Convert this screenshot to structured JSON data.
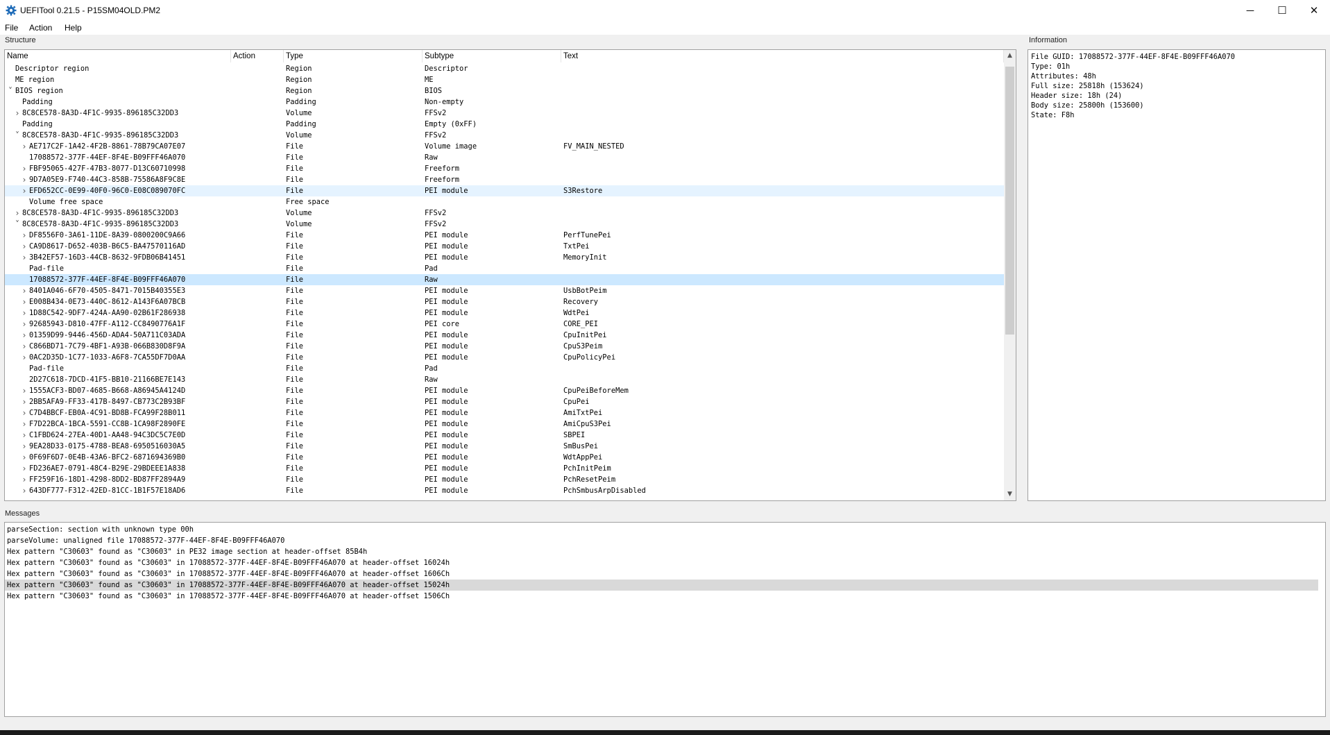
{
  "window": {
    "title": "UEFITool 0.21.5 - P15SM04OLD.PM2",
    "minimize_glyph": "─",
    "maximize_glyph": "☐",
    "close_glyph": "✕",
    "icon": "gear-icon"
  },
  "menu": [
    {
      "label": "File"
    },
    {
      "label": "Action"
    },
    {
      "label": "Help"
    }
  ],
  "structure": {
    "label": "Structure",
    "columns": [
      "Name",
      "Action",
      "Type",
      "Subtype",
      "Text"
    ],
    "rows": [
      {
        "name": "Descriptor region",
        "type": "Region",
        "subtype": "Descriptor",
        "text": ""
      },
      {
        "name": "ME region",
        "type": "Region",
        "subtype": "ME",
        "text": ""
      },
      {
        "name": "BIOS region",
        "type": "Region",
        "subtype": "BIOS",
        "text": ""
      },
      {
        "name": "Padding",
        "type": "Padding",
        "subtype": "Non-empty",
        "text": ""
      },
      {
        "name": "8C8CE578-8A3D-4F1C-9935-896185C32DD3",
        "type": "Volume",
        "subtype": "FFSv2",
        "text": ""
      },
      {
        "name": "Padding",
        "type": "Padding",
        "subtype": "Empty (0xFF)",
        "text": ""
      },
      {
        "name": "8C8CE578-8A3D-4F1C-9935-896185C32DD3",
        "type": "Volume",
        "subtype": "FFSv2",
        "text": ""
      },
      {
        "name": "AE717C2F-1A42-4F2B-8861-78B79CA07E07",
        "type": "File",
        "subtype": "Volume image",
        "text": "FV_MAIN_NESTED"
      },
      {
        "name": "17088572-377F-44EF-8F4E-B09FFF46A070",
        "type": "File",
        "subtype": "Raw",
        "text": ""
      },
      {
        "name": "FBF95065-427F-47B3-8077-D13C60710998",
        "type": "File",
        "subtype": "Freeform",
        "text": ""
      },
      {
        "name": "9D7A05E9-F740-44C3-858B-75586A8F9C8E",
        "type": "File",
        "subtype": "Freeform",
        "text": ""
      },
      {
        "name": "EFD652CC-0E99-40F0-96C0-E08C089070FC",
        "type": "File",
        "subtype": "PEI module",
        "text": "S3Restore"
      },
      {
        "name": "Volume free space",
        "type": "Free space",
        "subtype": "",
        "text": ""
      },
      {
        "name": "8C8CE578-8A3D-4F1C-9935-896185C32DD3",
        "type": "Volume",
        "subtype": "FFSv2",
        "text": ""
      },
      {
        "name": "8C8CE578-8A3D-4F1C-9935-896185C32DD3",
        "type": "Volume",
        "subtype": "FFSv2",
        "text": ""
      },
      {
        "name": "DF8556F0-3A61-11DE-8A39-0800200C9A66",
        "type": "File",
        "subtype": "PEI module",
        "text": "PerfTunePei"
      },
      {
        "name": "CA9D8617-D652-403B-B6C5-BA47570116AD",
        "type": "File",
        "subtype": "PEI module",
        "text": "TxtPei"
      },
      {
        "name": "3B42EF57-16D3-44CB-8632-9FDB06B41451",
        "type": "File",
        "subtype": "PEI module",
        "text": "MemoryInit"
      },
      {
        "name": "Pad-file",
        "type": "File",
        "subtype": "Pad",
        "text": ""
      },
      {
        "name": "17088572-377F-44EF-8F4E-B09FFF46A070",
        "type": "File",
        "subtype": "Raw",
        "text": ""
      },
      {
        "name": "8401A046-6F70-4505-8471-7015B40355E3",
        "type": "File",
        "subtype": "PEI module",
        "text": "UsbBotPeim"
      },
      {
        "name": "E008B434-0E73-440C-8612-A143F6A07BCB",
        "type": "File",
        "subtype": "PEI module",
        "text": "Recovery"
      },
      {
        "name": "1D88C542-9DF7-424A-AA90-02B61F286938",
        "type": "File",
        "subtype": "PEI module",
        "text": "WdtPei"
      },
      {
        "name": "92685943-D810-47FF-A112-CC8490776A1F",
        "type": "File",
        "subtype": "PEI core",
        "text": "CORE_PEI"
      },
      {
        "name": "01359D99-9446-456D-ADA4-50A711C03ADA",
        "type": "File",
        "subtype": "PEI module",
        "text": "CpuInitPei"
      },
      {
        "name": "C866BD71-7C79-4BF1-A93B-066B830D8F9A",
        "type": "File",
        "subtype": "PEI module",
        "text": "CpuS3Peim"
      },
      {
        "name": "0AC2D35D-1C77-1033-A6F8-7CA55DF7D0AA",
        "type": "File",
        "subtype": "PEI module",
        "text": "CpuPolicyPei"
      },
      {
        "name": "Pad-file",
        "type": "File",
        "subtype": "Pad",
        "text": ""
      },
      {
        "name": "2D27C618-7DCD-41F5-BB10-21166BE7E143",
        "type": "File",
        "subtype": "Raw",
        "text": ""
      },
      {
        "name": "1555ACF3-BD07-4685-B668-A86945A4124D",
        "type": "File",
        "subtype": "PEI module",
        "text": "CpuPeiBeforeMem"
      },
      {
        "name": "2BB5AFA9-FF33-417B-8497-CB773C2B93BF",
        "type": "File",
        "subtype": "PEI module",
        "text": "CpuPei"
      },
      {
        "name": "C7D4BBCF-EB0A-4C91-BD8B-FCA99F28B011",
        "type": "File",
        "subtype": "PEI module",
        "text": "AmiTxtPei"
      },
      {
        "name": "F7D22BCA-1BCA-5591-CC8B-1CA98F2890FE",
        "type": "File",
        "subtype": "PEI module",
        "text": "AmiCpuS3Pei"
      },
      {
        "name": "C1FBD624-27EA-40D1-AA48-94C3DC5C7E0D",
        "type": "File",
        "subtype": "PEI module",
        "text": "SBPEI"
      },
      {
        "name": "9EA28D33-0175-4788-BEA8-6950516030A5",
        "type": "File",
        "subtype": "PEI module",
        "text": "SmBusPei"
      },
      {
        "name": "0F69F6D7-0E4B-43A6-BFC2-6871694369B0",
        "type": "File",
        "subtype": "PEI module",
        "text": "WdtAppPei"
      },
      {
        "name": "FD236AE7-0791-48C4-B29E-29BDEEE1A838",
        "type": "File",
        "subtype": "PEI module",
        "text": "PchInitPeim"
      },
      {
        "name": "FF259F16-18D1-4298-8DD2-BD87FF2894A9",
        "type": "File",
        "subtype": "PEI module",
        "text": "PchResetPeim"
      },
      {
        "name": "643DF777-F312-42ED-81CC-1B1F57E18AD6",
        "type": "File",
        "subtype": "PEI module",
        "text": "PchSmbusArpDisabled"
      }
    ]
  },
  "information": {
    "label": "Information",
    "lines": [
      "File GUID: 17088572-377F-44EF-8F4E-B09FFF46A070",
      "Type: 01h",
      "Attributes: 48h",
      "Full size: 25818h (153624)",
      "Header size: 18h (24)",
      "Body size: 25800h (153600)",
      "State: F8h"
    ]
  },
  "messages": {
    "label": "Messages",
    "lines": [
      "parseSection: section with unknown type 00h",
      "parseVolume: unaligned file 17088572-377F-44EF-8F4E-B09FFF46A070",
      "Hex pattern \"C30603\" found as \"C30603\" in PE32 image section at header-offset 85B4h",
      "Hex pattern \"C30603\" found as \"C30603\" in 17088572-377F-44EF-8F4E-B09FFF46A070 at header-offset 16024h",
      "Hex pattern \"C30603\" found as \"C30603\" in 17088572-377F-44EF-8F4E-B09FFF46A070 at header-offset 1606Ch",
      "Hex pattern \"C30603\" found as \"C30603\" in 17088572-377F-44EF-8F4E-B09FFF46A070 at header-offset 15024h",
      "Hex pattern \"C30603\" found as \"C30603\" in 17088572-377F-44EF-8F4E-B09FFF46A070 at header-offset 1506Ch"
    ]
  },
  "colors": {
    "selection": "#cce8ff",
    "hover": "#e5f3ff",
    "message_highlight": "#d9d9d9"
  }
}
